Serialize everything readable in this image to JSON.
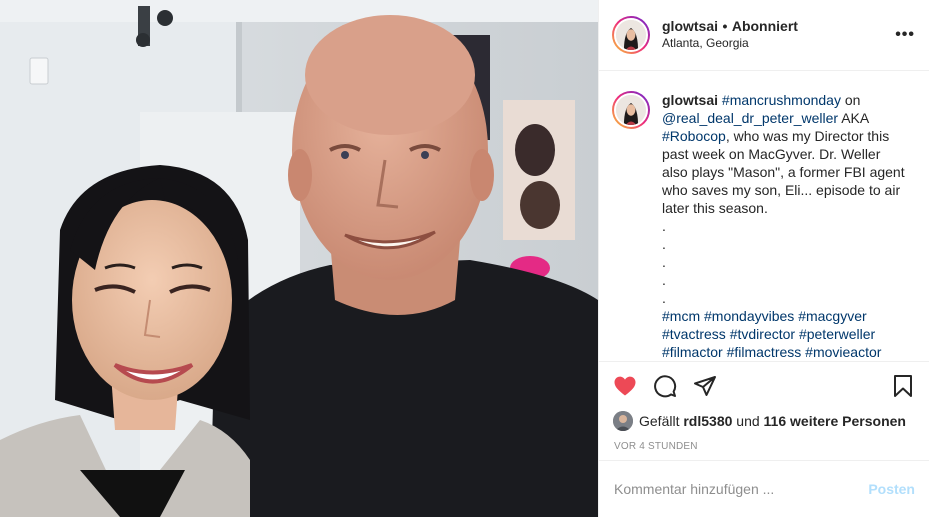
{
  "header": {
    "username": "glowtsai",
    "separator": "•",
    "follow_status": "Abonniert",
    "location": "Atlanta, Georgia",
    "more_icon": "more-horizontal-icon"
  },
  "caption": {
    "username": "glowtsai",
    "parts": [
      {
        "text": "#mancrushmonday",
        "tag": true
      },
      {
        "text": " on ",
        "tag": false
      },
      {
        "text": "@real_deal_dr_peter_weller",
        "tag": true
      },
      {
        "text": " AKA ",
        "tag": false
      },
      {
        "text": "#Robocop",
        "tag": true
      },
      {
        "text": ", who was my Director this past week on MacGyver. Dr. Weller also plays \"Mason\", a former FBI agent who saves my son, Eli... episode to air later this season.",
        "tag": false
      }
    ],
    "dots": [
      ".",
      ".",
      ".",
      ".",
      "."
    ],
    "hashtags": [
      "#mcm",
      "#mondayvibes",
      "#macgyver",
      "#tvactress",
      "#tvdirector",
      "#peterweller",
      "#filmactor",
      "#filmactress",
      "#movieactor"
    ]
  },
  "actions": {
    "like_icon": "heart-filled-icon",
    "comment_icon": "comment-icon",
    "share_icon": "share-icon",
    "save_icon": "bookmark-icon",
    "like_color": "#ed4956"
  },
  "likes": {
    "prefix": "Gefällt",
    "user": "rdl5380",
    "middle": "und",
    "others": "116 weitere Personen"
  },
  "timestamp": "VOR 4 STUNDEN",
  "comment": {
    "placeholder": "Kommentar hinzufügen ...",
    "post_label": "Posten",
    "post_color": "#b2dffc"
  }
}
